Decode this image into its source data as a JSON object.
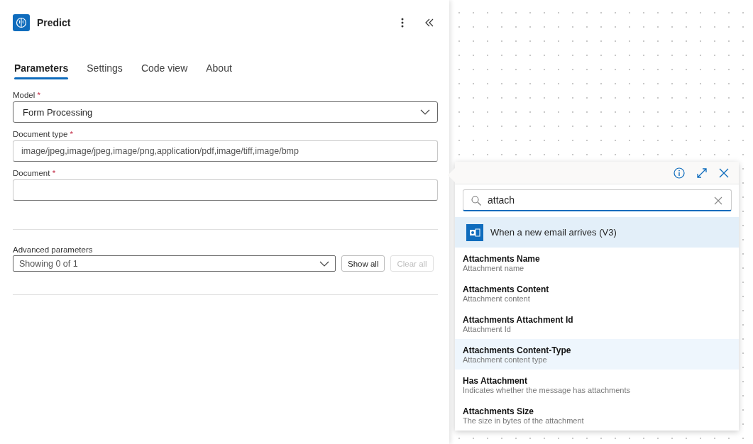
{
  "panel": {
    "title": "Predict"
  },
  "tabs": [
    {
      "label": "Parameters",
      "selected": true
    },
    {
      "label": "Settings",
      "selected": false
    },
    {
      "label": "Code view",
      "selected": false
    },
    {
      "label": "About",
      "selected": false
    }
  ],
  "fields": [
    {
      "kind": "dropdown",
      "label": "Model",
      "required_mark": "*",
      "value": "Form Processing"
    },
    {
      "kind": "text",
      "label": "Document type",
      "required_mark": "*",
      "value": "image/jpeg,image/jpeg,image/png,application/pdf,image/tiff,image/bmp"
    },
    {
      "kind": "text",
      "label": "Document",
      "required_mark": "*"
    }
  ],
  "advanced": {
    "label": "Advanced parameters",
    "value": "Showing 0 of 1",
    "buttons": [
      {
        "label": "Show all",
        "disabled": false
      },
      {
        "label": "Clear all",
        "disabled": true
      }
    ]
  },
  "picker": {
    "search": {
      "value": "attach"
    },
    "source": {
      "title": "When a new email arrives (V3)"
    },
    "items": [
      {
        "title": "Attachments Name",
        "description": "Attachment name",
        "selected": false
      },
      {
        "title": "Attachments Content",
        "description": "Attachment content",
        "selected": false
      },
      {
        "title": "Attachments Attachment Id",
        "description": "Attachment Id",
        "selected": false
      },
      {
        "title": "Attachments Content-Type",
        "description": "Attachment content type",
        "selected": true
      },
      {
        "title": "Has Attachment",
        "description": "Indicates whether the message has attachments",
        "selected": false
      },
      {
        "title": "Attachments Size",
        "description": "The size in bytes of the attachment",
        "selected": false
      }
    ]
  }
}
